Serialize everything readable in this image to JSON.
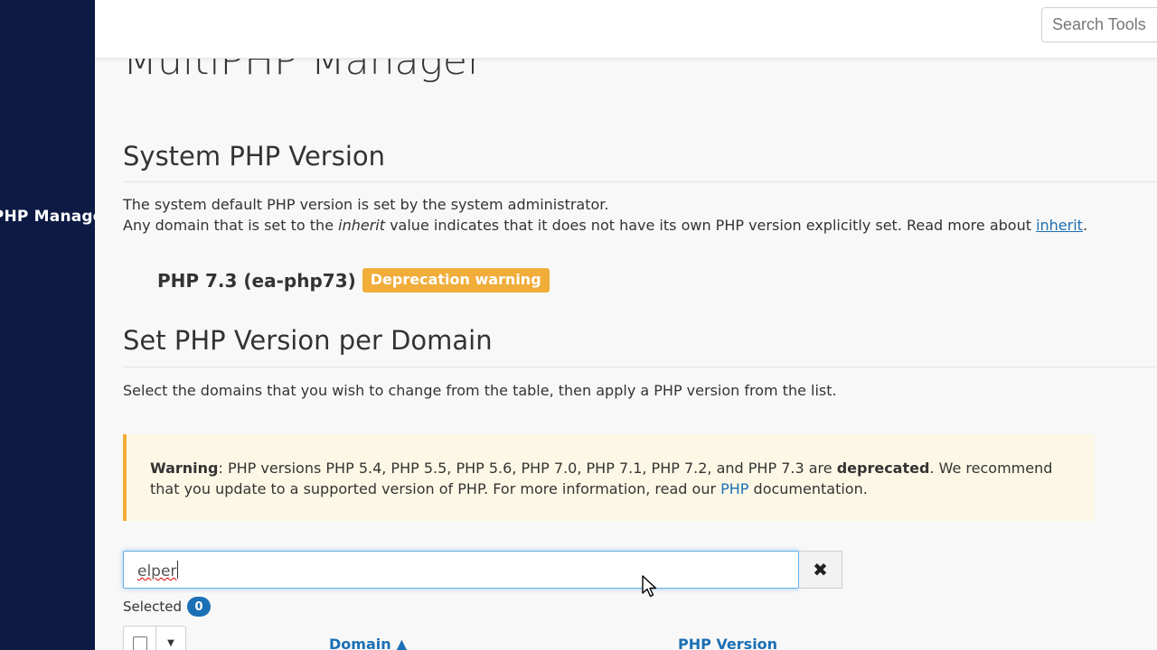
{
  "sidebar": {
    "items": [
      {
        "label": "MultiPHP Manager"
      }
    ]
  },
  "header": {
    "search_placeholder": "Search Tools"
  },
  "page": {
    "title": "MultiPHP Manager"
  },
  "system_php": {
    "heading": "System PHP Version",
    "line1": "The system default PHP version is set by the system administrator.",
    "line2_pre": "Any domain that is set to the ",
    "line2_em": "inherit",
    "line2_post": " value indicates that it does not have its own PHP version explicitly set. Read more about ",
    "line2_link": "inherit",
    "line2_end": ".",
    "version_label": "PHP 7.3 (ea-php73)",
    "badge": "Deprecation warning"
  },
  "per_domain": {
    "heading": "Set PHP Version per Domain",
    "description": "Select the domains that you wish to change from the table, then apply a PHP version from the list."
  },
  "alert": {
    "strong": "Warning",
    "text1": ": PHP versions PHP 5.4, PHP 5.5, PHP 5.6, PHP 7.0, PHP 7.1, PHP 7.2, and PHP 7.3 are ",
    "strong2": "deprecated",
    "text2": ". We recommend",
    "text3": "that you update to a supported version of PHP. For more information, read our ",
    "link": "PHP",
    "text4": " documentation."
  },
  "filter": {
    "value": "elper"
  },
  "clear_icon": "✖",
  "selected": {
    "label": "Selected",
    "count": "0"
  },
  "table": {
    "columns": [
      "Domain ▲",
      "PHP Version"
    ]
  },
  "colors": {
    "sidebar": "#0c1a44",
    "warning": "#f0ad3a",
    "link": "#1b6fb5"
  }
}
